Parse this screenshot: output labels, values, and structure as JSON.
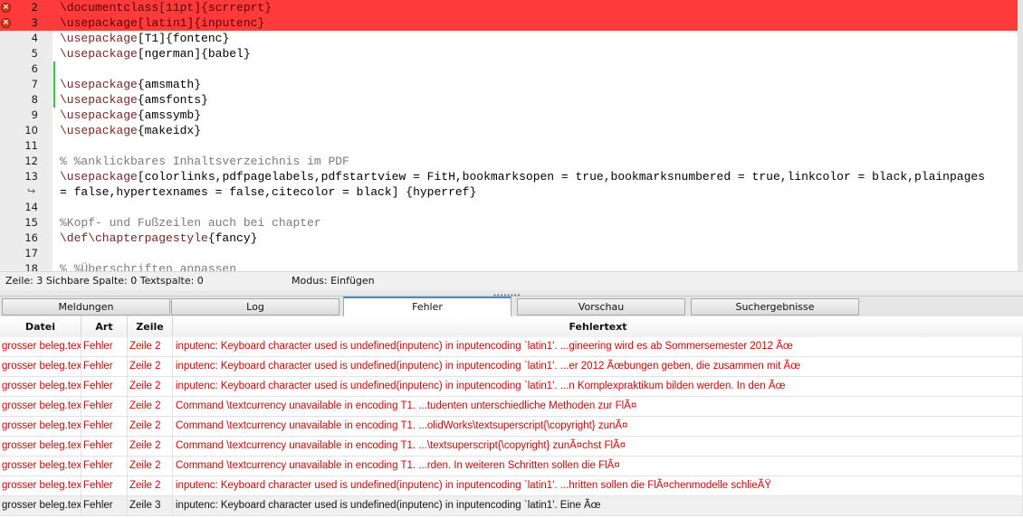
{
  "editor": {
    "lines": [
      {
        "num": "2",
        "error": true,
        "marker": false,
        "parts": [
          {
            "t": "\\documentclass",
            "c": "cmd"
          },
          {
            "t": "[11pt]{scrreprt}"
          }
        ]
      },
      {
        "num": "3",
        "error": true,
        "marker": false,
        "parts": [
          {
            "t": "\\usepackage",
            "c": "cmd"
          },
          {
            "t": "[latin1]{inputenc}"
          }
        ]
      },
      {
        "num": "4",
        "error": false,
        "marker": false,
        "parts": [
          {
            "t": "\\usepackage",
            "c": "cmd"
          },
          {
            "t": "[T1]{fontenc}"
          }
        ]
      },
      {
        "num": "5",
        "error": false,
        "marker": false,
        "parts": [
          {
            "t": "\\usepackage",
            "c": "cmd"
          },
          {
            "t": "[ngerman]{babel}"
          }
        ]
      },
      {
        "num": "6",
        "error": false,
        "marker": true,
        "parts": []
      },
      {
        "num": "7",
        "error": false,
        "marker": true,
        "parts": [
          {
            "t": "\\usepackage",
            "c": "cmd"
          },
          {
            "t": "{amsmath}"
          }
        ]
      },
      {
        "num": "8",
        "error": false,
        "marker": true,
        "parts": [
          {
            "t": "\\usepackage",
            "c": "cmd"
          },
          {
            "t": "{amsfonts}"
          }
        ]
      },
      {
        "num": "9",
        "error": false,
        "marker": false,
        "parts": [
          {
            "t": "\\usepackage",
            "c": "cmd"
          },
          {
            "t": "{amssymb}"
          }
        ]
      },
      {
        "num": "10",
        "error": false,
        "marker": false,
        "parts": [
          {
            "t": "\\usepackage",
            "c": "cmd"
          },
          {
            "t": "{makeidx}"
          }
        ]
      },
      {
        "num": "11",
        "error": false,
        "marker": false,
        "parts": []
      },
      {
        "num": "12",
        "error": false,
        "marker": false,
        "parts": [
          {
            "t": "% %anklickbares Inhaltsverzeichnis im PDF",
            "c": "cmt"
          }
        ]
      },
      {
        "num": "13",
        "error": false,
        "marker": false,
        "parts": [
          {
            "t": "\\usepackage",
            "c": "cmd"
          },
          {
            "t": "[colorlinks,pdfpagelabels,pdfstartview = FitH,bookmarksopen = true,bookmarksnumbered = true,linkcolor = black,plainpages"
          }
        ]
      },
      {
        "num": "",
        "wrap": true,
        "error": false,
        "marker": false,
        "parts": [
          {
            "t": "= false,hypertexnames = false,citecolor = black] {hyperref}"
          }
        ]
      },
      {
        "num": "14",
        "error": false,
        "marker": false,
        "parts": []
      },
      {
        "num": "15",
        "error": false,
        "marker": false,
        "parts": [
          {
            "t": "%Kopf- und Fußzeilen auch bei chapter",
            "c": "cmt"
          }
        ]
      },
      {
        "num": "16",
        "error": false,
        "marker": false,
        "parts": [
          {
            "t": "\\def\\chapterpagestyle",
            "c": "cmd"
          },
          {
            "t": "{fancy}"
          }
        ]
      },
      {
        "num": "17",
        "error": false,
        "marker": false,
        "parts": []
      },
      {
        "num": "18",
        "error": false,
        "marker": false,
        "parts": [
          {
            "t": "% %Überschriften anpassen",
            "c": "cmt"
          }
        ]
      }
    ]
  },
  "status": {
    "position": "Zeile: 3 Sichbare Spalte: 0 Textspalte: 0",
    "mode": "Modus: Einfügen"
  },
  "tabs": [
    {
      "label": "Meldungen",
      "active": false
    },
    {
      "label": "Log",
      "active": false
    },
    {
      "label": "Fehler",
      "active": true
    },
    {
      "label": "Vorschau",
      "active": false
    },
    {
      "label": "Suchergebnisse",
      "active": false
    }
  ],
  "table": {
    "columns": [
      "Datei",
      "Art",
      "Zeile",
      "Fehlertext"
    ],
    "rows": [
      {
        "file": "grosser beleg.tex",
        "type": "Fehler",
        "line": "Zeile 2",
        "text": "inputenc: Keyboard character used is undefined(inputenc) in inputencoding `latin1'. ...gineering wird es ab Sommersemester 2012 Ãœ",
        "selected": false
      },
      {
        "file": "grosser beleg.tex",
        "type": "Fehler",
        "line": "Zeile 2",
        "text": "inputenc: Keyboard character used is undefined(inputenc) in inputencoding `latin1'. ...er 2012 Ãœbungen geben, die zusammen mit Ãœ",
        "selected": false
      },
      {
        "file": "grosser beleg.tex",
        "type": "Fehler",
        "line": "Zeile 2",
        "text": "inputenc: Keyboard character used is undefined(inputenc) in inputencoding `latin1'. ...n Komplexpraktikum bilden werden. In den Ãœ",
        "selected": false
      },
      {
        "file": "grosser beleg.tex",
        "type": "Fehler",
        "line": "Zeile 2",
        "text": "Command \\textcurrency unavailable in encoding T1. ...tudenten unterschiedliche Methoden zur FlÃ¤",
        "selected": false
      },
      {
        "file": "grosser beleg.tex",
        "type": "Fehler",
        "line": "Zeile 2",
        "text": "Command \\textcurrency unavailable in encoding T1. ...olidWorks\\textsuperscript{\\copyright} zunÃ¤",
        "selected": false
      },
      {
        "file": "grosser beleg.tex",
        "type": "Fehler",
        "line": "Zeile 2",
        "text": "Command \\textcurrency unavailable in encoding T1. ...\\textsuperscript{\\copyright} zunÃ¤chst FlÃ¤",
        "selected": false
      },
      {
        "file": "grosser beleg.tex",
        "type": "Fehler",
        "line": "Zeile 2",
        "text": "Command \\textcurrency unavailable in encoding T1. ...rden. In weiteren Schritten sollen die FlÃ¤",
        "selected": false
      },
      {
        "file": "grosser beleg.tex",
        "type": "Fehler",
        "line": "Zeile 2",
        "text": "inputenc: Keyboard character used is undefined(inputenc) in inputencoding `latin1'. ...hritten sollen die FlÃ¤chenmodelle schlieÃŸ",
        "selected": false
      },
      {
        "file": "grosser beleg.tex",
        "type": "Fehler",
        "line": "Zeile 3",
        "text": "inputenc: Keyboard character used is undefined(inputenc) in inputencoding `latin1'. Eine Ãœ",
        "selected": true
      }
    ]
  }
}
